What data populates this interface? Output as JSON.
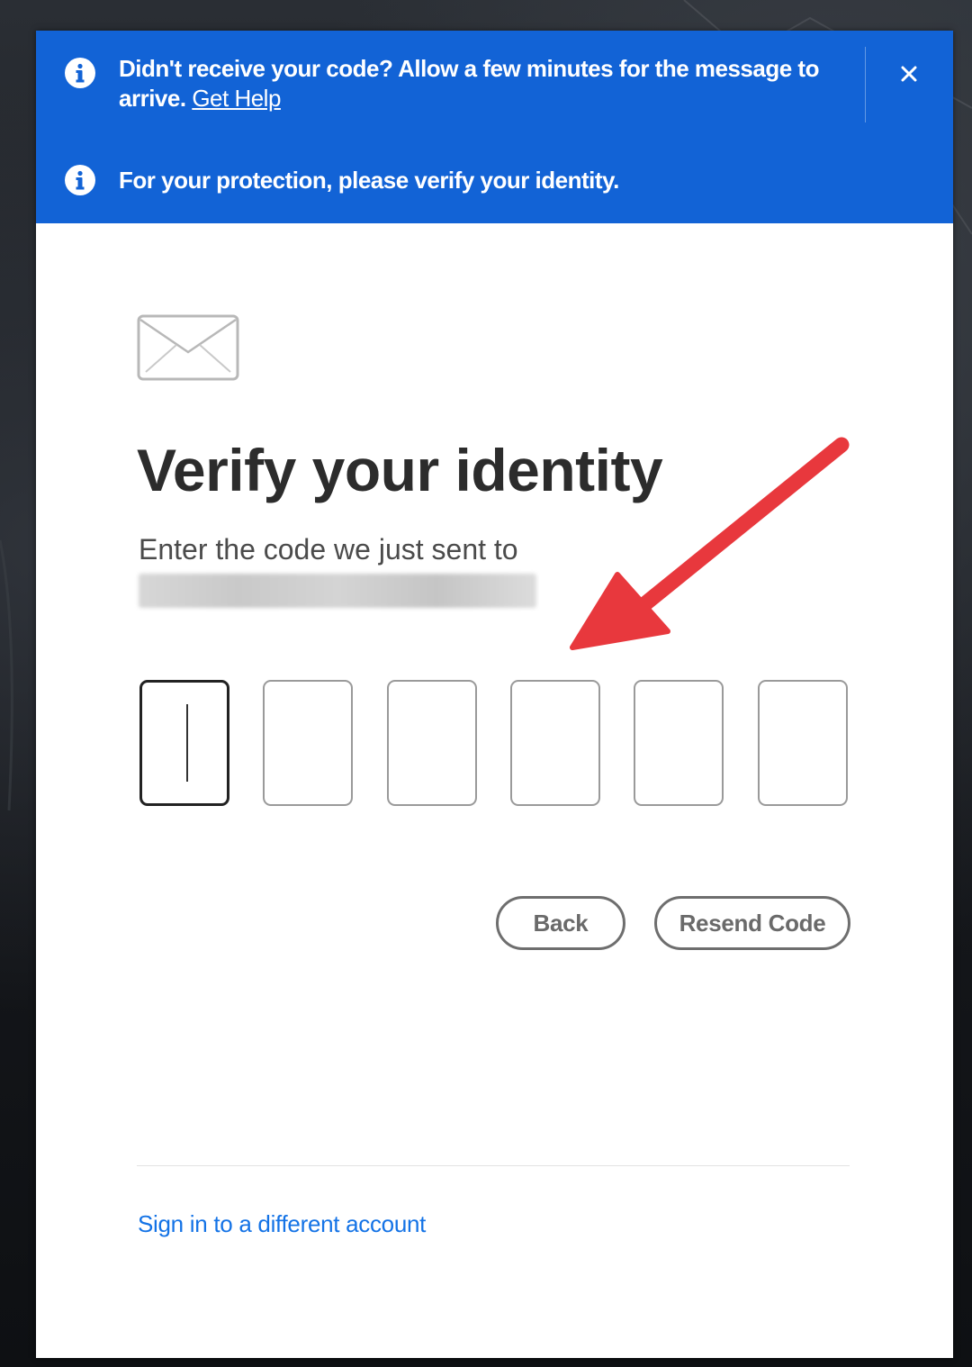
{
  "banners": {
    "help": {
      "icon": "info-icon",
      "message": "Didn't receive your code? Allow a few minutes for the message to arrive.",
      "link_label": "Get Help",
      "close_icon": "close-icon"
    },
    "protection": {
      "icon": "info-icon",
      "message": "For your protection, please verify your identity."
    },
    "background_color": "#1263d6"
  },
  "main": {
    "icon": "envelope-icon",
    "title": "Verify your identity",
    "subtitle": "Enter the code we just sent to",
    "code_inputs": [
      {
        "value": "",
        "focused": true
      },
      {
        "value": "",
        "focused": false
      },
      {
        "value": "",
        "focused": false
      },
      {
        "value": "",
        "focused": false
      },
      {
        "value": "",
        "focused": false
      },
      {
        "value": "",
        "focused": false
      }
    ],
    "buttons": {
      "back_label": "Back",
      "resend_label": "Resend Code"
    },
    "annotation": {
      "icon": "red-arrow-icon",
      "color": "#e8383d"
    }
  },
  "footer": {
    "switch_account_label": "Sign in to a different account",
    "link_color": "#1473e6"
  }
}
